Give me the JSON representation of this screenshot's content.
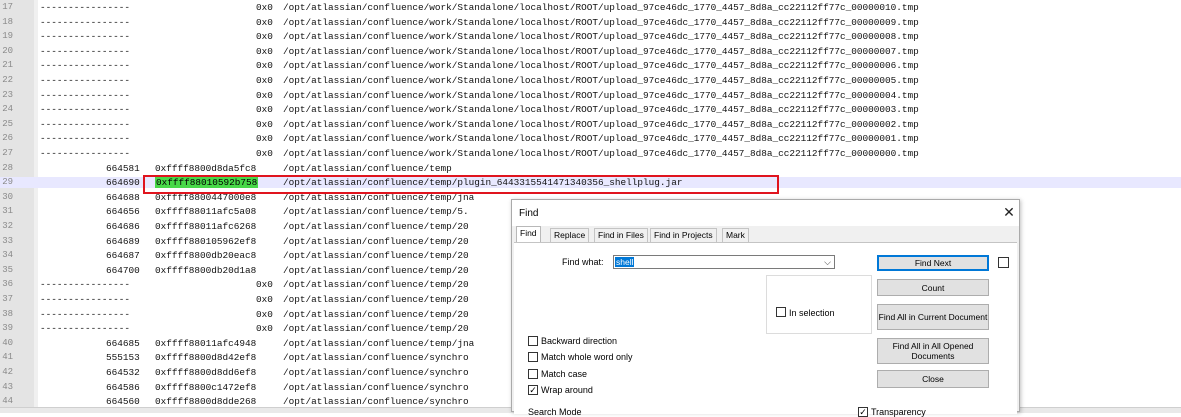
{
  "editor": {
    "lines": [
      {
        "num": "17",
        "pid": "",
        "dash": "----------------",
        "offset": "0x0",
        "path": "/opt/atlassian/confluence/work/Standalone/localhost/ROOT/upload_97ce46dc_1770_4457_8d8a_cc22112ff77c_00000010.tmp"
      },
      {
        "num": "18",
        "pid": "",
        "dash": "----------------",
        "offset": "0x0",
        "path": "/opt/atlassian/confluence/work/Standalone/localhost/ROOT/upload_97ce46dc_1770_4457_8d8a_cc22112ff77c_00000009.tmp"
      },
      {
        "num": "19",
        "pid": "",
        "dash": "----------------",
        "offset": "0x0",
        "path": "/opt/atlassian/confluence/work/Standalone/localhost/ROOT/upload_97ce46dc_1770_4457_8d8a_cc22112ff77c_00000008.tmp"
      },
      {
        "num": "20",
        "pid": "",
        "dash": "----------------",
        "offset": "0x0",
        "path": "/opt/atlassian/confluence/work/Standalone/localhost/ROOT/upload_97ce46dc_1770_4457_8d8a_cc22112ff77c_00000007.tmp"
      },
      {
        "num": "21",
        "pid": "",
        "dash": "----------------",
        "offset": "0x0",
        "path": "/opt/atlassian/confluence/work/Standalone/localhost/ROOT/upload_97ce46dc_1770_4457_8d8a_cc22112ff77c_00000006.tmp"
      },
      {
        "num": "22",
        "pid": "",
        "dash": "----------------",
        "offset": "0x0",
        "path": "/opt/atlassian/confluence/work/Standalone/localhost/ROOT/upload_97ce46dc_1770_4457_8d8a_cc22112ff77c_00000005.tmp"
      },
      {
        "num": "23",
        "pid": "",
        "dash": "----------------",
        "offset": "0x0",
        "path": "/opt/atlassian/confluence/work/Standalone/localhost/ROOT/upload_97ce46dc_1770_4457_8d8a_cc22112ff77c_00000004.tmp"
      },
      {
        "num": "24",
        "pid": "",
        "dash": "----------------",
        "offset": "0x0",
        "path": "/opt/atlassian/confluence/work/Standalone/localhost/ROOT/upload_97ce46dc_1770_4457_8d8a_cc22112ff77c_00000003.tmp"
      },
      {
        "num": "25",
        "pid": "",
        "dash": "----------------",
        "offset": "0x0",
        "path": "/opt/atlassian/confluence/work/Standalone/localhost/ROOT/upload_97ce46dc_1770_4457_8d8a_cc22112ff77c_00000002.tmp"
      },
      {
        "num": "26",
        "pid": "",
        "dash": "----------------",
        "offset": "0x0",
        "path": "/opt/atlassian/confluence/work/Standalone/localhost/ROOT/upload_97ce46dc_1770_4457_8d8a_cc22112ff77c_00000001.tmp"
      },
      {
        "num": "27",
        "pid": "",
        "dash": "----------------",
        "offset": "0x0",
        "path": "/opt/atlassian/confluence/work/Standalone/localhost/ROOT/upload_97ce46dc_1770_4457_8d8a_cc22112ff77c_00000000.tmp"
      },
      {
        "num": "28",
        "pid": "664581",
        "dash": "",
        "offset": "0xffff8800d8da5fc8",
        "path": "/opt/atlassian/confluence/temp"
      },
      {
        "num": "29",
        "pid": "664690",
        "dash": "",
        "offset": "0xffff88010592b758",
        "path": "/opt/atlassian/confluence/temp/plugin_6443315541471340356_shellplug.jar",
        "highlight": true,
        "current": true
      },
      {
        "num": "30",
        "pid": "664688",
        "dash": "",
        "offset": "0xffff8800447000e8",
        "path": "/opt/atlassian/confluence/temp/jna"
      },
      {
        "num": "31",
        "pid": "664656",
        "dash": "",
        "offset": "0xffff88011afc5a08",
        "path": "/opt/atlassian/confluence/temp/5."
      },
      {
        "num": "32",
        "pid": "664686",
        "dash": "",
        "offset": "0xffff88011afc6268",
        "path": "/opt/atlassian/confluence/temp/20"
      },
      {
        "num": "33",
        "pid": "664689",
        "dash": "",
        "offset": "0xffff880105962ef8",
        "path": "/opt/atlassian/confluence/temp/20"
      },
      {
        "num": "34",
        "pid": "664687",
        "dash": "",
        "offset": "0xffff8800db20eac8",
        "path": "/opt/atlassian/confluence/temp/20"
      },
      {
        "num": "35",
        "pid": "664700",
        "dash": "",
        "offset": "0xffff8800db20d1a8",
        "path": "/opt/atlassian/confluence/temp/20"
      },
      {
        "num": "36",
        "pid": "",
        "dash": "----------------",
        "offset": "0x0",
        "path": "/opt/atlassian/confluence/temp/20"
      },
      {
        "num": "37",
        "pid": "",
        "dash": "----------------",
        "offset": "0x0",
        "path": "/opt/atlassian/confluence/temp/20"
      },
      {
        "num": "38",
        "pid": "",
        "dash": "----------------",
        "offset": "0x0",
        "path": "/opt/atlassian/confluence/temp/20"
      },
      {
        "num": "39",
        "pid": "",
        "dash": "----------------",
        "offset": "0x0",
        "path": "/opt/atlassian/confluence/temp/20"
      },
      {
        "num": "40",
        "pid": "664685",
        "dash": "",
        "offset": "0xffff88011afc4948",
        "path": "/opt/atlassian/confluence/temp/jna"
      },
      {
        "num": "41",
        "pid": "555153",
        "dash": "",
        "offset": "0xffff8800d8d42ef8",
        "path": "/opt/atlassian/confluence/synchro"
      },
      {
        "num": "42",
        "pid": "664532",
        "dash": "",
        "offset": "0xffff8800d8dd6ef8",
        "path": "/opt/atlassian/confluence/synchro"
      },
      {
        "num": "43",
        "pid": "664586",
        "dash": "",
        "offset": "0xffff8800c1472ef8",
        "path": "/opt/atlassian/confluence/synchro"
      },
      {
        "num": "44",
        "pid": "664560",
        "dash": "",
        "offset": "0xffff8800d8dde268",
        "path": "/opt/atlassian/confluence/synchro"
      }
    ]
  },
  "find_dialog": {
    "title": "Find",
    "close_glyph": "✕",
    "tabs": [
      {
        "label": "Find",
        "active": true
      },
      {
        "label": "Replace"
      },
      {
        "label": "Find in Files"
      },
      {
        "label": "Find in Projects"
      },
      {
        "label": "Mark"
      }
    ],
    "find_what_label": "Find what:",
    "find_what_value": "shell",
    "in_selection_label": "In selection",
    "buttons": {
      "find_next": "Find Next",
      "count": "Count",
      "find_all_current": "Find All in Current Document",
      "find_all_opened": "Find All in All Opened Documents",
      "close": "Close"
    },
    "options": {
      "backward": {
        "label": "Backward direction",
        "checked": false
      },
      "whole_word": {
        "label": "Match whole word only",
        "checked": false
      },
      "match_case": {
        "label": "Match case",
        "checked": false
      },
      "wrap_around": {
        "label": "Wrap around",
        "checked": true
      }
    },
    "search_mode_label": "Search Mode",
    "transparency_label": "Transparency"
  },
  "colors": {
    "highlight": "#48d848",
    "red_box": "#e0141e",
    "selection": "#0078d7"
  }
}
